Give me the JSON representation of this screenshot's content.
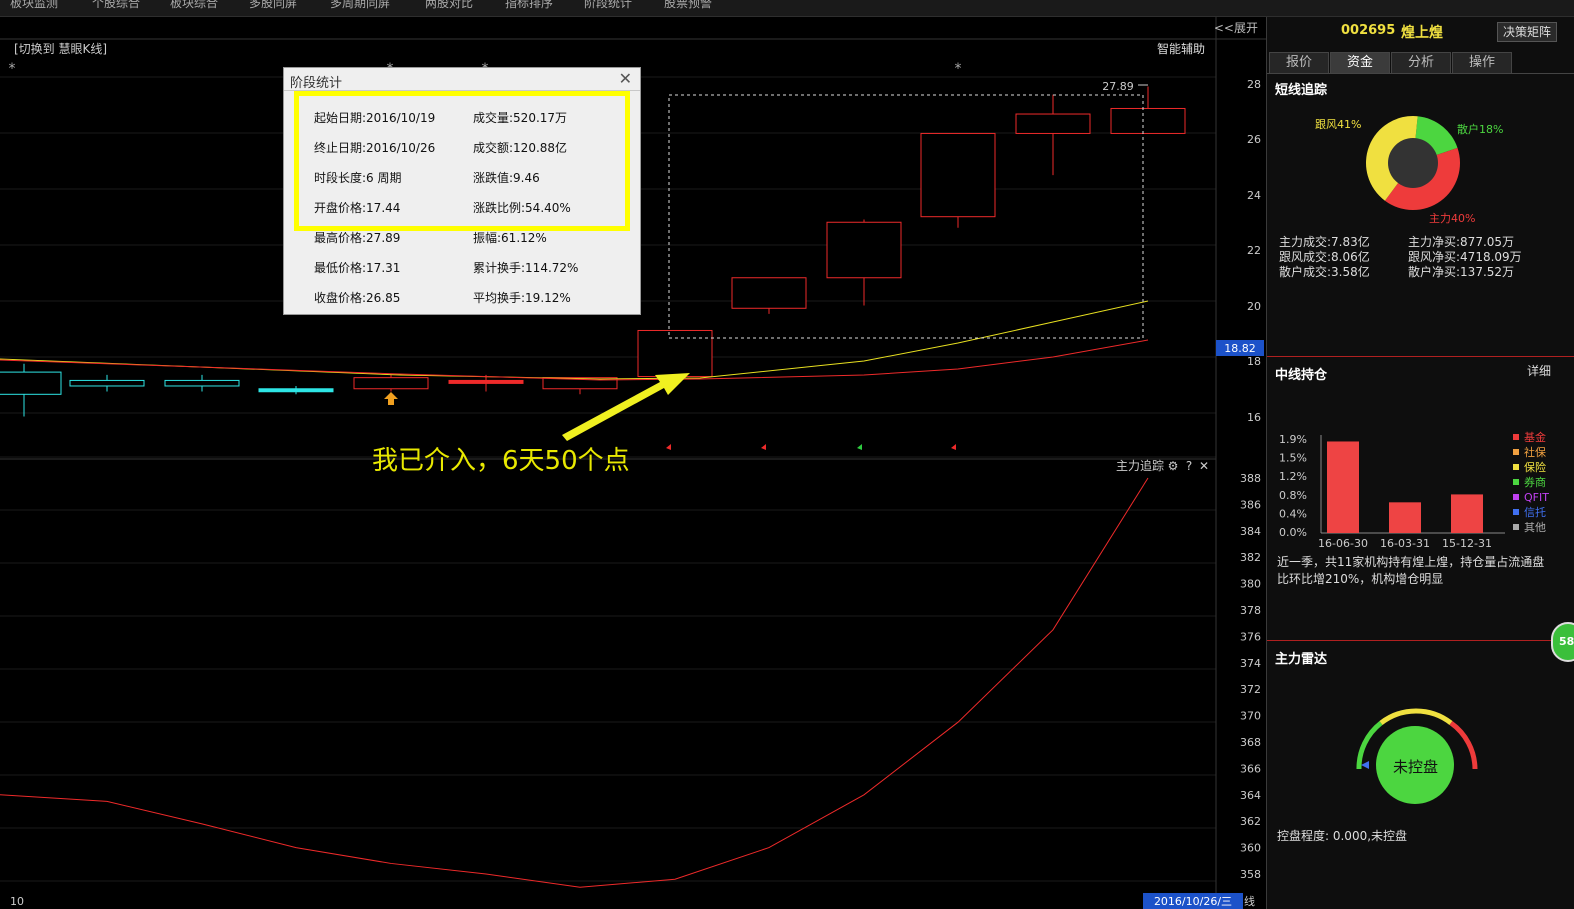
{
  "menu": [
    "板块监测",
    "个股综合",
    "板块综合",
    "多股同屏",
    "多周期同屏",
    "两股对比",
    "指标排序",
    "阶段统计",
    "股票预警"
  ],
  "chart_header": {
    "left_label": "[切换到 慧眼K线]",
    "right_label": "智能辅助",
    "expand": "<<展开",
    "high_marker": "27.89",
    "current_price": "18.82",
    "date_tag": "2016/10/26/三",
    "xian_label": "线",
    "bottom_left": "10",
    "indicator_title": "主力追踪",
    "gear": "⚙",
    "question": "?",
    "close": "✕"
  },
  "price_axis": [
    "28",
    "26",
    "24",
    "22",
    "20",
    "18",
    "16"
  ],
  "indicator_axis": [
    "388",
    "386",
    "384",
    "382",
    "380",
    "378",
    "376",
    "374",
    "372",
    "370",
    "368",
    "366",
    "364",
    "362",
    "360",
    "358"
  ],
  "annotation": "我已介入，6天50个点",
  "popup": {
    "title": "阶段统计",
    "close": "✕",
    "rows": [
      [
        "起始日期:2016/10/19",
        "成交量:520.17万"
      ],
      [
        "终止日期:2016/10/26",
        "成交额:120.88亿"
      ],
      [
        "时段长度:6 周期",
        "涨跌值:9.46"
      ],
      [
        "开盘价格:17.44",
        "涨跌比例:54.40%"
      ],
      [
        "最高价格:27.89",
        "振幅:61.12%"
      ],
      [
        "最低价格:17.31",
        "累计换手:114.72%"
      ],
      [
        "收盘价格:26.85",
        "平均换手:19.12%"
      ]
    ]
  },
  "stock": {
    "code": "002695",
    "name": "煌上煌",
    "button": "决策矩阵"
  },
  "tabs": [
    "报价",
    "资金",
    "分析",
    "操作"
  ],
  "short_track": {
    "title": "短线追踪",
    "legend": {
      "follow": "跟风41%",
      "retail": "散户18%",
      "main": "主力40%"
    },
    "stats": [
      [
        "主力成交:7.83亿",
        "主力净买:877.05万"
      ],
      [
        "跟风成交:8.06亿",
        "跟风净买:4718.09万"
      ],
      [
        "散户成交:3.58亿",
        "散户净买:137.52万"
      ]
    ],
    "pie": [
      {
        "name": "follow",
        "value": 41,
        "color": "#f0e040"
      },
      {
        "name": "retail",
        "value": 18,
        "color": "#4cd640"
      },
      {
        "name": "main",
        "value": 40,
        "color": "#ee3b3b"
      }
    ]
  },
  "mid_hold": {
    "title": "中线持仓",
    "detail": "详细",
    "yticks": [
      "1.9%",
      "1.5%",
      "1.2%",
      "0.8%",
      "0.4%",
      "0.0%"
    ],
    "chart_data": {
      "type": "bar",
      "categories": [
        "16-06-30",
        "16-03-31",
        "15-12-31"
      ],
      "values": [
        1.85,
        0.62,
        0.78
      ],
      "ylim": [
        0,
        1.9
      ]
    },
    "legend": [
      "基金",
      "社保",
      "保险",
      "券商",
      "QFIT",
      "信托",
      "其他"
    ],
    "legend_colors": [
      "#ee3b3b",
      "#f0a040",
      "#f0e040",
      "#4cd640",
      "#c040f0",
      "#4070f0",
      "#aaaaaa"
    ],
    "desc1": "近一季，共11家机构持有煌上煌，持仓量占流通盘",
    "desc2": "比环比增210%，机构增仓明显"
  },
  "radar": {
    "title": "主力雷达",
    "status": "未控盘",
    "desc": "控盘程度: 0.000,未控盘",
    "badge": "58"
  }
}
